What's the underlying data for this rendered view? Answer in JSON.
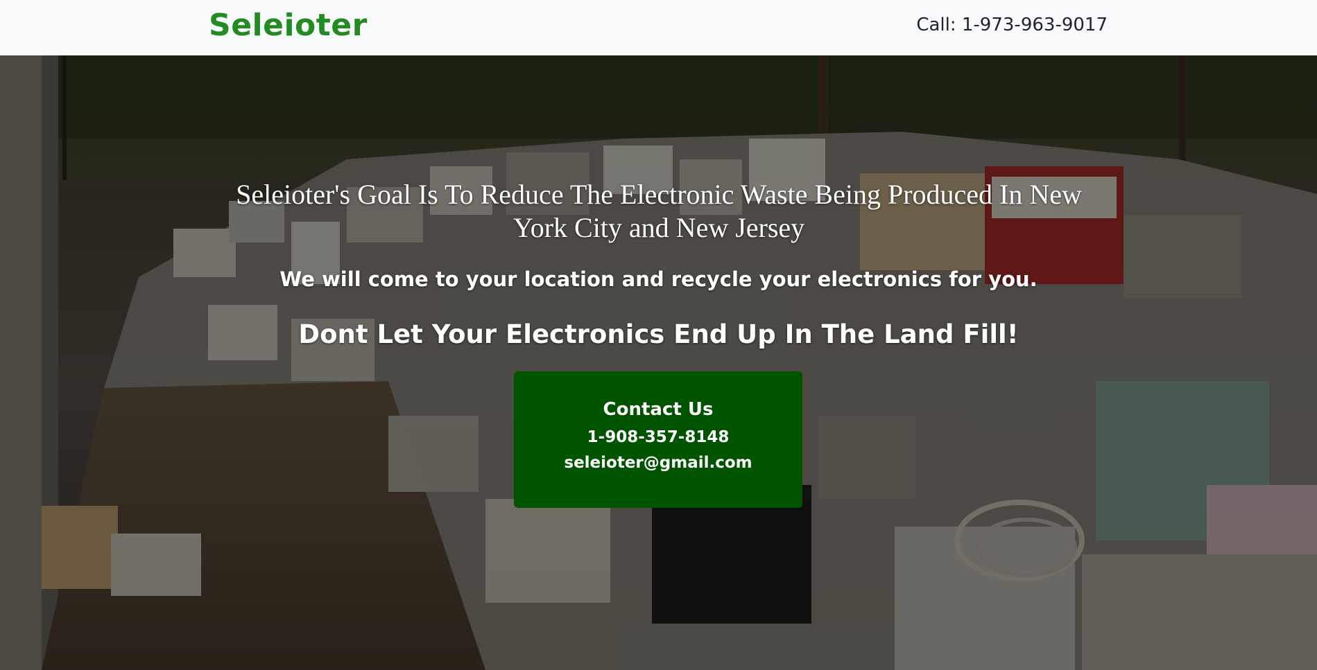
{
  "navbar": {
    "brand": "Seleioter",
    "call": "Call: 1-973-963-9017"
  },
  "hero": {
    "goal": "Seleioter's Goal Is To Reduce The Electronic Waste Being Produced In New York City and New Jersey",
    "tagline": "We will come to your location and recycle your electronics for you.",
    "landfill": "Dont Let Your Electronics End Up In The Land Fill!",
    "background_image": "e-waste-pile-photo"
  },
  "contact": {
    "title": "Contact Us",
    "phone": "1-908-357-8148",
    "email": "seleioter@gmail.com"
  },
  "colors": {
    "brand": "#228b22",
    "navbar_bg": "#f8f9fa",
    "contact_bg": "#005400",
    "hero_text": "#ffffff"
  }
}
